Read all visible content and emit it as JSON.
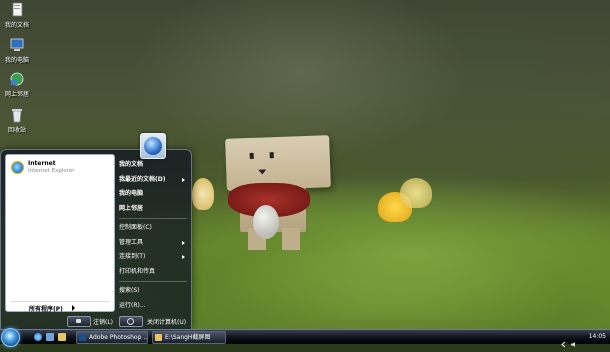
{
  "desktop": {
    "icons": [
      {
        "label": "我的文档",
        "icon": "documents-icon"
      },
      {
        "label": "我的电脑",
        "icon": "computer-icon"
      },
      {
        "label": "网上邻居",
        "icon": "network-icon"
      },
      {
        "label": "回收站",
        "icon": "recycle-bin-icon"
      }
    ]
  },
  "start_menu": {
    "pinned": {
      "title": "Internet",
      "subtitle": "Internet Explorer",
      "icon": "ie-icon"
    },
    "all_programs": "所有程序(P)",
    "right_items": [
      {
        "label": "我的文档",
        "bold": true,
        "submenu": false
      },
      {
        "label": "我最近的文档(D)",
        "bold": true,
        "submenu": true
      },
      {
        "label": "我的电脑",
        "bold": true,
        "submenu": false
      },
      {
        "label": "网上邻居",
        "bold": true,
        "submenu": false
      },
      {
        "label": "控制面板(C)",
        "bold": false,
        "submenu": false
      },
      {
        "label": "管理工具",
        "bold": false,
        "submenu": true
      },
      {
        "label": "连接到(T)",
        "bold": false,
        "submenu": true
      },
      {
        "label": "打印机和传真",
        "bold": false,
        "submenu": false
      },
      {
        "label": "搜索(S)",
        "bold": false,
        "submenu": false
      },
      {
        "label": "运行(R)...",
        "bold": false,
        "submenu": false
      }
    ],
    "logoff_label": "注销(L)",
    "shutdown_label": "关闭计算机(U)"
  },
  "taskbar": {
    "tasks": [
      {
        "label": "Adobe Photoshop ...",
        "icon": "photoshop-icon"
      },
      {
        "label": "E:\\SangH截屏图",
        "icon": "folder-icon"
      }
    ],
    "clock": "14:05"
  },
  "colors": {
    "menu_bg": "#121822",
    "taskbar_bg": "#10141c",
    "accent": "#2b6fc7"
  }
}
